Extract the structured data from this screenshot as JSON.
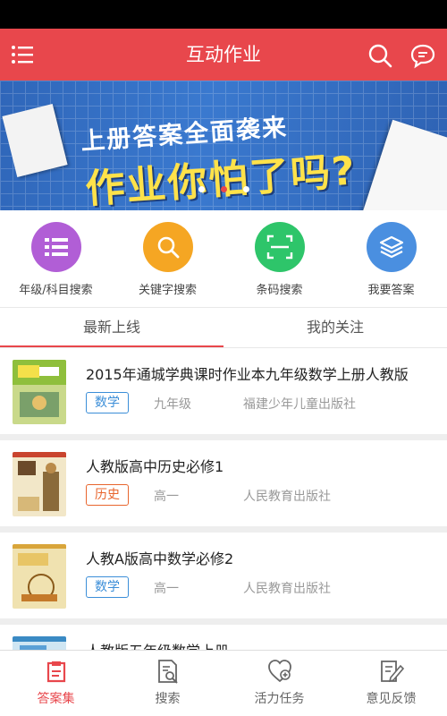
{
  "header": {
    "title": "互动作业"
  },
  "banner": {
    "line1": "上册答案全面袭来",
    "line2": "作业你怕了吗?",
    "dots": 3,
    "active_dot": 1
  },
  "quick_actions": [
    {
      "label": "年级/科目搜索",
      "icon": "list-icon",
      "color": "#b15ed6"
    },
    {
      "label": "关键字搜索",
      "icon": "search-icon",
      "color": "#f5a623"
    },
    {
      "label": "条码搜索",
      "icon": "scan-icon",
      "color": "#2ec56a"
    },
    {
      "label": "我要答案",
      "icon": "layers-icon",
      "color": "#4a8fe0"
    }
  ],
  "tabs": [
    {
      "label": "最新上线",
      "active": true
    },
    {
      "label": "我的关注",
      "active": false
    }
  ],
  "books": [
    {
      "title": "2015年通城学典课时作业本九年级数学上册人教版",
      "subject": "数学",
      "grade": "九年级",
      "publisher": "福建少年儿童出版社"
    },
    {
      "title": "人教版高中历史必修1",
      "subject": "历史",
      "grade": "高一",
      "publisher": "人民教育出版社"
    },
    {
      "title": "人教A版高中数学必修2",
      "subject": "数学",
      "grade": "高一",
      "publisher": "人民教育出版社"
    },
    {
      "title": "人教版五年级数学上册",
      "subject": "",
      "grade": "",
      "publisher": ""
    }
  ],
  "bottom_nav": [
    {
      "label": "答案集",
      "active": true
    },
    {
      "label": "搜索",
      "active": false
    },
    {
      "label": "活力任务",
      "active": false
    },
    {
      "label": "意见反馈",
      "active": false
    }
  ],
  "colors": {
    "brand": "#e8474c",
    "tag_blue": "#3b8ed8",
    "tag_orange": "#e8652d"
  }
}
